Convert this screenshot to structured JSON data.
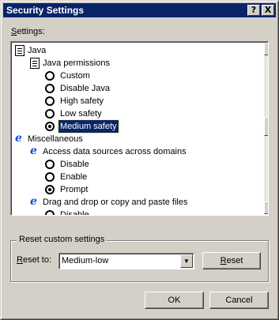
{
  "window": {
    "title": "Security Settings",
    "help_glyph": "?",
    "close_glyph": "X"
  },
  "settings": {
    "label_accel": "S",
    "label_rest": "ettings:"
  },
  "tree": {
    "java": "Java",
    "java_permissions": "Java permissions",
    "opt_custom": "Custom",
    "opt_disable_java": "Disable Java",
    "opt_high_safety": "High safety",
    "opt_low_safety": "Low safety",
    "opt_medium_safety": "Medium safety",
    "miscellaneous": "Miscellaneous",
    "access_data": "Access data sources across domains",
    "opt_disable": "Disable",
    "opt_enable": "Enable",
    "opt_prompt": "Prompt",
    "drag_drop": "Drag and drop or copy and paste files",
    "opt_disable_partial": "Disable"
  },
  "reset_group": {
    "title": "Reset custom settings",
    "reset_to_accel": "R",
    "reset_to_rest": "eset to:",
    "selected_value": "Medium-low",
    "reset_button_accel": "R",
    "reset_button_rest": "eset"
  },
  "buttons": {
    "ok": "OK",
    "cancel": "Cancel"
  }
}
